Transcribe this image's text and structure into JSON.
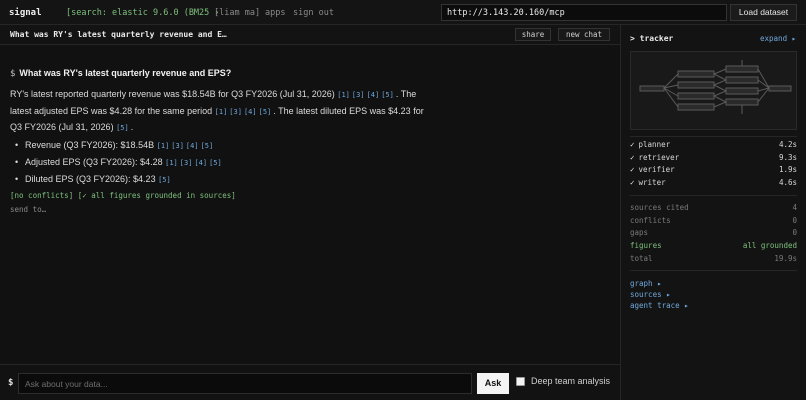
{
  "topbar": {
    "brand": "signal",
    "search_tag": "[search: elastic 9.6.0 (BM25 ›",
    "user_tag": "[liam ma]",
    "apps": "apps",
    "sign_out": "sign out",
    "url_value": "http://3.143.20.160/mcp",
    "load_label": "Load dataset"
  },
  "chat": {
    "title": "What was RY's latest quarterly revenue and E…",
    "share_label": "share",
    "new_chat_label": "new chat",
    "prompt_symbol": "$",
    "question": "What was RY's latest quarterly revenue and EPS?",
    "answer": {
      "s1": "RY's latest reported quarterly revenue was $18.54B for Q3 FY2026 (Jul 31, 2026)",
      "s1_cites": [
        "[1]",
        "[3]",
        "[4]",
        "[5]"
      ],
      "s1_end": ". The",
      "s2": "latest adjusted EPS was $4.28 for the same period",
      "s2_cites": [
        "[1]",
        "[3]",
        "[4]",
        "[5]"
      ],
      "s2_end": ". The latest diluted EPS was $4.23",
      "s3": "for Q3 FY2026 (Jul 31, 2026)",
      "s3_cites": [
        "[5]"
      ],
      "s3_end": "."
    },
    "bullets": [
      {
        "text": "Revenue (Q3 FY2026): $18.54B",
        "cites": [
          "[1]",
          "[3]",
          "[4]",
          "[5]"
        ]
      },
      {
        "text": "Adjusted EPS (Q3 FY2026): $4.28",
        "cites": [
          "[1]",
          "[3]",
          "[4]",
          "[5]"
        ]
      },
      {
        "text": "Diluted EPS (Q3 FY2026): $4.23",
        "cites": [
          "[5]"
        ]
      }
    ],
    "status": "[no conflicts]  [✓ all figures grounded in sources]",
    "send_to": "send to…"
  },
  "input": {
    "prompt_symbol": "$",
    "placeholder": "Ask about your data...",
    "ask_label": "Ask",
    "deep_label": "Deep team analysis",
    "deep_checked": false
  },
  "tracker": {
    "title": "> tracker",
    "expand_label": "expand ▸",
    "agents": [
      {
        "check": "✓",
        "name": "planner",
        "time": "4.2s"
      },
      {
        "check": "✓",
        "name": "retriever",
        "time": "9.3s"
      },
      {
        "check": "✓",
        "name": "verifier",
        "time": "1.9s"
      },
      {
        "check": "✓",
        "name": "writer",
        "time": "4.6s"
      }
    ],
    "stats": [
      {
        "label": "sources cited",
        "value": "4"
      },
      {
        "label": "conflicts",
        "value": "0"
      },
      {
        "label": "gaps",
        "value": "0"
      },
      {
        "label": "figures",
        "value": "all grounded"
      },
      {
        "label": "total",
        "value": "19.9s"
      }
    ],
    "links": [
      "graph ▸",
      "sources ▸",
      "agent trace ▸"
    ]
  },
  "colors": {
    "background": "#111111",
    "accent_blue": "#6fa8dc",
    "accent_green": "#7ec07e"
  }
}
